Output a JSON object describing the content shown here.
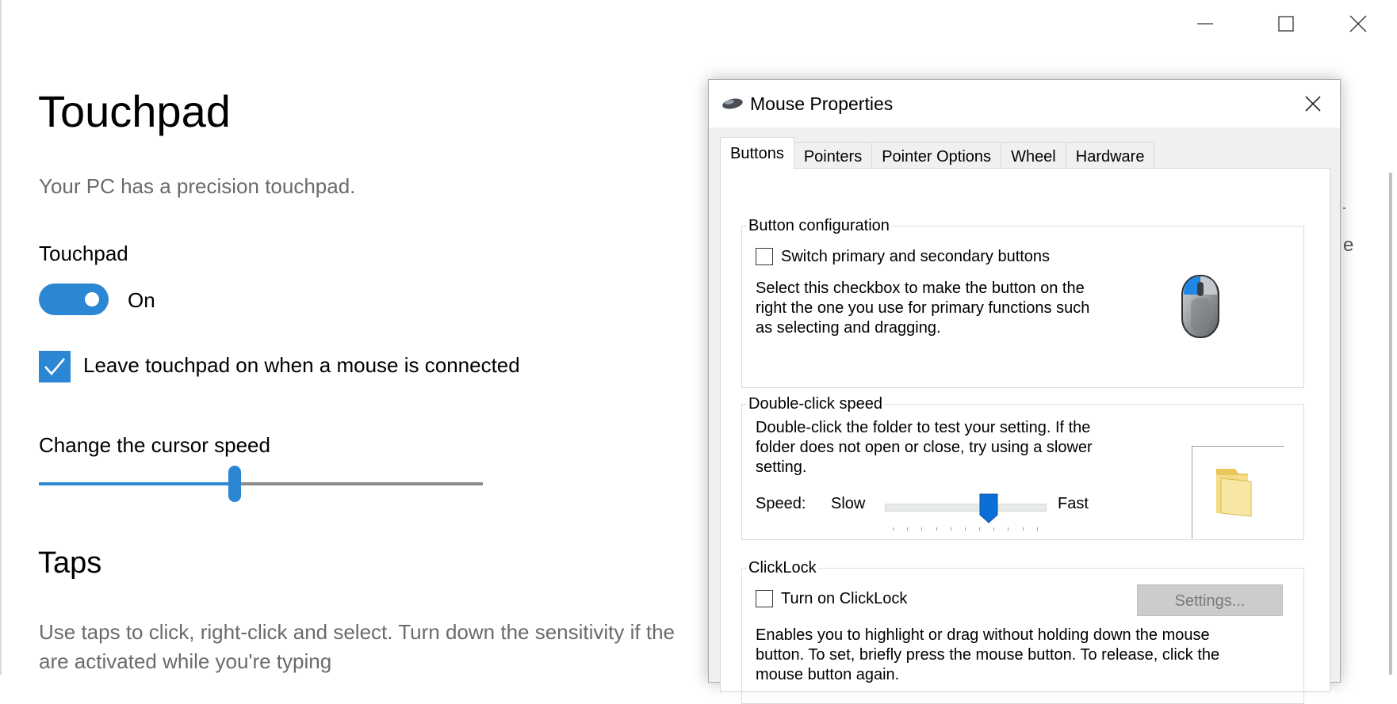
{
  "window": {
    "minimize_icon": "minimize-icon",
    "maximize_icon": "maximize-icon",
    "close_icon": "close-icon"
  },
  "settings": {
    "title": "Touchpad",
    "subtitle": "Your PC has a precision touchpad.",
    "touchpad_label": "Touchpad",
    "toggle_state": "On",
    "toggle_on": true,
    "leave_on_label": "Leave touchpad on when a mouse is connected",
    "leave_on_checked": true,
    "cursor_speed_label": "Change the cursor speed",
    "cursor_speed_fraction": 0.445,
    "taps_heading": "Taps",
    "taps_desc_line1": "Use taps to click, right-click and select. Turn down the sensitivity if the",
    "taps_desc_line2": "are activated while you're typing",
    "edge_text": "e",
    "accent_color": "#2b87d3"
  },
  "dialog": {
    "title": "Mouse Properties",
    "icon": "mouse-icon",
    "tabs": [
      {
        "label": "Buttons",
        "active": true
      },
      {
        "label": "Pointers",
        "active": false
      },
      {
        "label": "Pointer Options",
        "active": false
      },
      {
        "label": "Wheel",
        "active": false
      },
      {
        "label": "Hardware",
        "active": false
      }
    ],
    "button_config": {
      "group_label": "Button configuration",
      "switch_label": "Switch primary and secondary buttons",
      "switch_checked": false,
      "description_line1": "Select this checkbox to make the button on the",
      "description_line2": "right the one you use for primary functions such",
      "description_line3": "as selecting and dragging."
    },
    "double_click": {
      "group_label": "Double-click speed",
      "description_line1": "Double-click the folder to test your setting. If the",
      "description_line2": "folder does not open or close, try using a slower",
      "description_line3": "setting.",
      "speed_label": "Speed:",
      "slow_label": "Slow",
      "fast_label": "Fast",
      "speed_fraction": 0.58
    },
    "clicklock": {
      "group_label": "ClickLock",
      "checkbox_label": "Turn on ClickLock",
      "checked": false,
      "settings_button": "Settings...",
      "description_line1": "Enables you to highlight or drag without holding down the mouse",
      "description_line2": "button. To set, briefly press the mouse button. To release, click the",
      "description_line3": "mouse button again."
    }
  }
}
